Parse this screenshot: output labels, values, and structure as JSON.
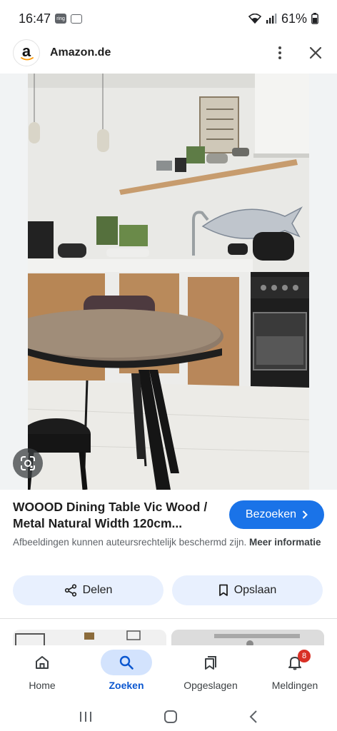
{
  "status_bar": {
    "time": "16:47",
    "icon_ring": "ring",
    "battery": "61%"
  },
  "header": {
    "site_name": "Amazon.de",
    "logo_letter": "a"
  },
  "result": {
    "title": "WOOOD Dining Table Vic Wood / Metal Natural Width 120cm...",
    "visit_label": "Bezoeken",
    "notice": "Afbeeldingen kunnen auteursrechtelijk beschermd zijn.",
    "notice_link": "Meer informatie",
    "share_label": "Delen",
    "save_label": "Opslaan"
  },
  "bottom_nav": {
    "items": [
      {
        "label": "Home",
        "icon": "home-icon",
        "active": false
      },
      {
        "label": "Zoeken",
        "icon": "search-icon",
        "active": true
      },
      {
        "label": "Opgeslagen",
        "icon": "collections-icon",
        "active": false
      },
      {
        "label": "Meldingen",
        "icon": "bell-icon",
        "active": false,
        "badge": "8"
      }
    ]
  },
  "colors": {
    "accent": "#1a73e8",
    "tonal": "#e8f0fe",
    "active_nav": "#0b57d0",
    "badge": "#d93025"
  }
}
